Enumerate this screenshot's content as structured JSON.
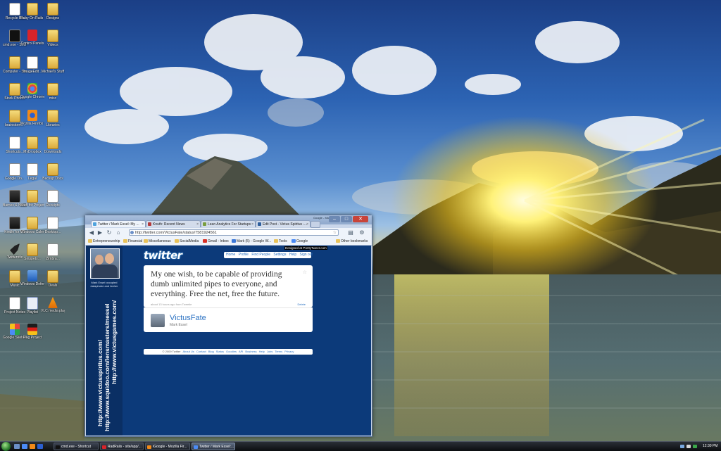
{
  "desktop": {
    "icons": [
      {
        "label": "Recycle Bin",
        "icon": "recycle-bin-icon"
      },
      {
        "label": "Ruby On Rails - Up A...",
        "icon": "folder-icon"
      },
      {
        "label": "Designs",
        "icon": "folder-icon"
      },
      {
        "label": "cmd.exe - Shortcut",
        "icon": "command-prompt-icon"
      },
      {
        "label": "Control Panels",
        "icon": "settings-icon"
      },
      {
        "label": "Videos",
        "icon": "folder-icon"
      },
      {
        "label": "Computer - Shortcut",
        "icon": "folder-icon"
      },
      {
        "label": "ImageEdit...",
        "icon": "document-icon"
      },
      {
        "label": "Michael's Stuff",
        "icon": "folder-icon"
      },
      {
        "label": "Stock Photos",
        "icon": "folder-icon"
      },
      {
        "label": "Google Chrome",
        "icon": "chrome-icon"
      },
      {
        "label": "misc",
        "icon": "folder-icon"
      },
      {
        "label": "brainstorm...",
        "icon": "folder-icon"
      },
      {
        "label": "Mozilla Firefox 3...",
        "icon": "firefox-icon"
      },
      {
        "label": "Libraries",
        "icon": "folder-icon"
      },
      {
        "label": "Shortcuts...",
        "icon": "document-icon"
      },
      {
        "label": "MyDropbox",
        "icon": "folder-icon"
      },
      {
        "label": "Downloads",
        "icon": "folder-icon"
      },
      {
        "label": "Google Do...",
        "icon": "document-icon"
      },
      {
        "label": "Legal",
        "icon": "document-icon"
      },
      {
        "label": "Backup Docs",
        "icon": "folder-icon"
      },
      {
        "label": "Barnes & Noble",
        "icon": "book-icon"
      },
      {
        "label": "Stuff for Projects",
        "icon": "folder-icon"
      },
      {
        "label": "Receipts",
        "icon": "document-icon"
      },
      {
        "label": "Kindle for PC",
        "icon": "book-icon"
      },
      {
        "label": "Windows Calendar",
        "icon": "folder-icon"
      },
      {
        "label": "Desktop...",
        "icon": "document-icon"
      },
      {
        "label": "Twitterrific",
        "icon": "bird-icon"
      },
      {
        "label": "Snippets...",
        "icon": "folder-icon"
      },
      {
        "label": "Zimbra...",
        "icon": "document-icon"
      },
      {
        "label": "Music",
        "icon": "folder-icon"
      },
      {
        "label": "Windows Defender",
        "icon": "shield-icon"
      },
      {
        "label": "Deals",
        "icon": "folder-icon"
      },
      {
        "label": "Project Notes",
        "icon": "document-icon"
      },
      {
        "label": "Playlist",
        "icon": "music-icon"
      },
      {
        "label": "VLC media player",
        "icon": "vlc-icon"
      },
      {
        "label": "Google SketchUp",
        "icon": "blocks-icon"
      },
      {
        "label": "Flag Project",
        "icon": "flag-icon"
      }
    ]
  },
  "browser": {
    "user_signature": "Google - Michael",
    "tabs": [
      {
        "label": "Twitter / Mark Essel: My ...",
        "active": true,
        "favicon_color": "#4fa3dd"
      },
      {
        "label": "Knuth: Recent News",
        "active": false,
        "favicon_color": "#b33b3b"
      },
      {
        "label": "Lean Analytics For Startups",
        "active": false,
        "favicon_color": "#7a9e3f"
      },
      {
        "label": "Edit Post - Victus Spiritus -...",
        "active": false,
        "favicon_color": "#2e5e9c"
      }
    ],
    "url": "http://twitter.com/VictusFate/status/7581924561",
    "bookmarks": [
      "Entrepreneurship",
      "Financial",
      "Miscellaneous",
      "SocialMedia",
      "Gmail - Inbox",
      "Mark (5) - Google W...",
      "Tools",
      "Google",
      "Other bookmarks"
    ]
  },
  "twitter": {
    "logo": "twitter",
    "designed_by": "Designed at PrettyTweet.com",
    "nav": [
      "Home",
      "Profile",
      "Find People",
      "Settings",
      "Help",
      "Sign out"
    ],
    "bio": "Mark Essel occupied dataphobe and techer",
    "side_urls": [
      "http://www.victusspiritus.com/",
      "http://www.squidoo.com/lensmasters/messel",
      "http://www.victusgames.com/"
    ],
    "tweet_text": "My one wish, to be capable of providing dumb unlimited pipes to everyone, and everything. Free the net, free the future.",
    "tweet_meta": "about 13 hours ago from Tweetie",
    "delete_label": "Delete",
    "author_screen": "VictusFate",
    "author_name": "Mark Essel",
    "footer_copy": "© 2009 Twitter",
    "footer_links": [
      "About Us",
      "Contact",
      "Blog",
      "Status",
      "Goodies",
      "API",
      "Business",
      "Help",
      "Jobs",
      "Terms",
      "Privacy"
    ]
  },
  "taskbar": {
    "tasks": [
      {
        "label": "cmd.exe - Shortcut",
        "icon_color": "#111111"
      },
      {
        "label": "RadRails - site/app/...",
        "icon_color": "#d8232a"
      },
      {
        "label": "iGoogle - Mozilla Fir...",
        "icon_color": "#f28a18"
      },
      {
        "label": "Twitter / Mark Essel:...",
        "icon_color": "#4b8bf5",
        "active": true
      }
    ],
    "clock": "12:30 PM"
  }
}
